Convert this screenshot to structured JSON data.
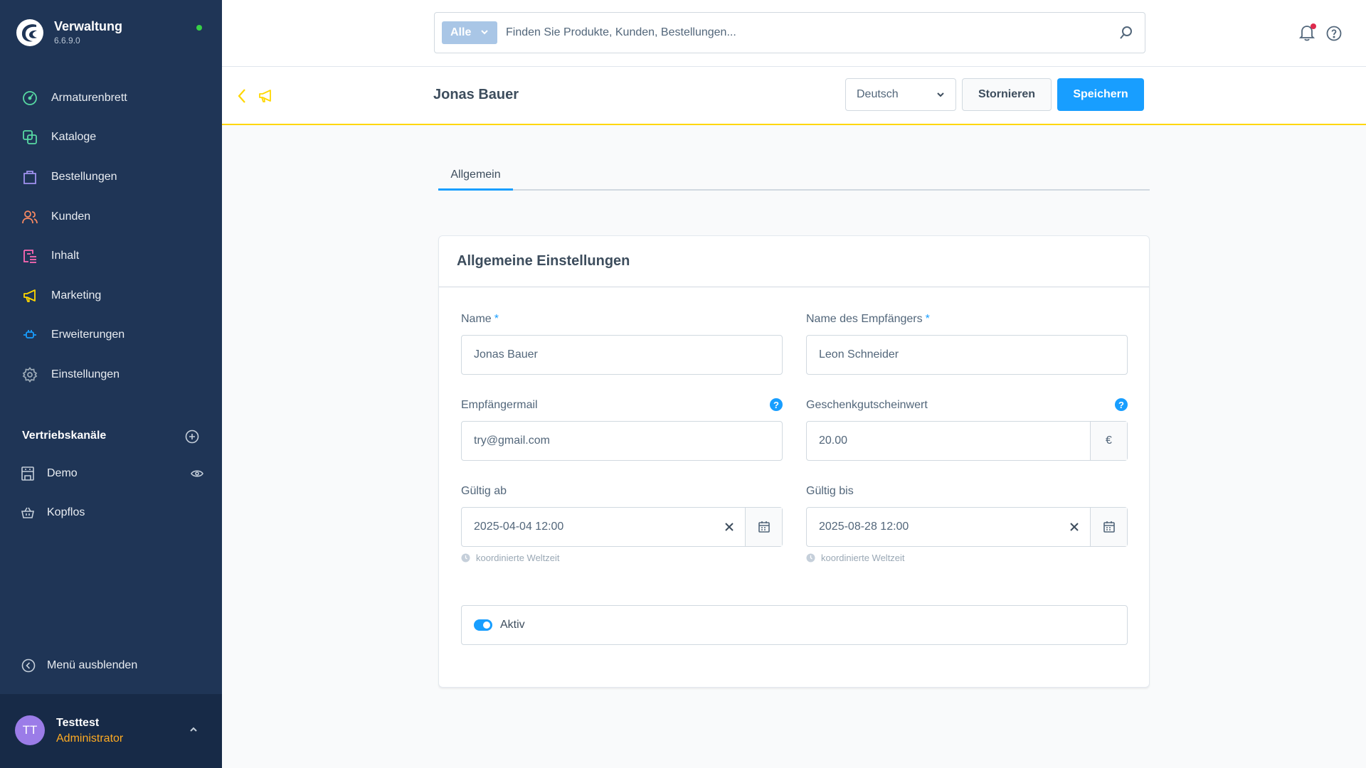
{
  "brand": {
    "name": "Verwaltung",
    "version": "6.6.9.0"
  },
  "sidebar": {
    "items": [
      {
        "label": "Armaturenbrett",
        "icon": "dashboard-icon",
        "color": "#57d9a3"
      },
      {
        "label": "Kataloge",
        "icon": "catalog-icon",
        "color": "#57d9a3"
      },
      {
        "label": "Bestellungen",
        "icon": "orders-icon",
        "color": "#a092f0"
      },
      {
        "label": "Kunden",
        "icon": "customers-icon",
        "color": "#f88962"
      },
      {
        "label": "Inhalt",
        "icon": "content-icon",
        "color": "#ff68b4"
      },
      {
        "label": "Marketing",
        "icon": "marketing-icon",
        "color": "#ffd700"
      },
      {
        "label": "Erweiterungen",
        "icon": "extensions-icon",
        "color": "#189eff"
      },
      {
        "label": "Einstellungen",
        "icon": "settings-icon",
        "color": "#9aa8b5"
      }
    ],
    "channels_title": "Vertriebskanäle",
    "channels": [
      {
        "label": "Demo",
        "icon": "storefront-icon"
      },
      {
        "label": "Kopflos",
        "icon": "basket-icon"
      }
    ],
    "collapse_label": "Menü ausblenden"
  },
  "user": {
    "initials": "TT",
    "name": "Testtest",
    "role": "Administrator"
  },
  "search": {
    "type_label": "Alle",
    "placeholder": "Finden Sie Produkte, Kunden, Bestellungen..."
  },
  "smartbar": {
    "title": "Jonas Bauer",
    "language": "Deutsch",
    "cancel_label": "Stornieren",
    "save_label": "Speichern"
  },
  "tabs": [
    {
      "label": "Allgemein"
    }
  ],
  "card": {
    "title": "Allgemeine Einstellungen",
    "fields": {
      "name": {
        "label": "Name",
        "required_mark": "*",
        "value": "Jonas Bauer"
      },
      "recipient_name": {
        "label": "Name des Empfängers",
        "required_mark": "*",
        "value": "Leon Schneider"
      },
      "recipient_mail": {
        "label": "Empfängermail",
        "help": "?",
        "value": "try@gmail.com"
      },
      "voucher_value": {
        "label": "Geschenkgutscheinwert",
        "help": "?",
        "value": "20.00",
        "currency": "€"
      },
      "valid_from": {
        "label": "Gültig ab",
        "value": "2025-04-04 12:00",
        "hint": "koordinierte Weltzeit"
      },
      "valid_until": {
        "label": "Gültig bis",
        "value": "2025-08-28 12:00",
        "hint": "koordinierte Weltzeit"
      }
    },
    "active": {
      "label": "Aktiv",
      "checked": true
    }
  },
  "colors": {
    "sidebar": "#1f3556",
    "accent": "#189eff",
    "smartbar_border": "#ffd700",
    "user_role": "#ffab22"
  }
}
